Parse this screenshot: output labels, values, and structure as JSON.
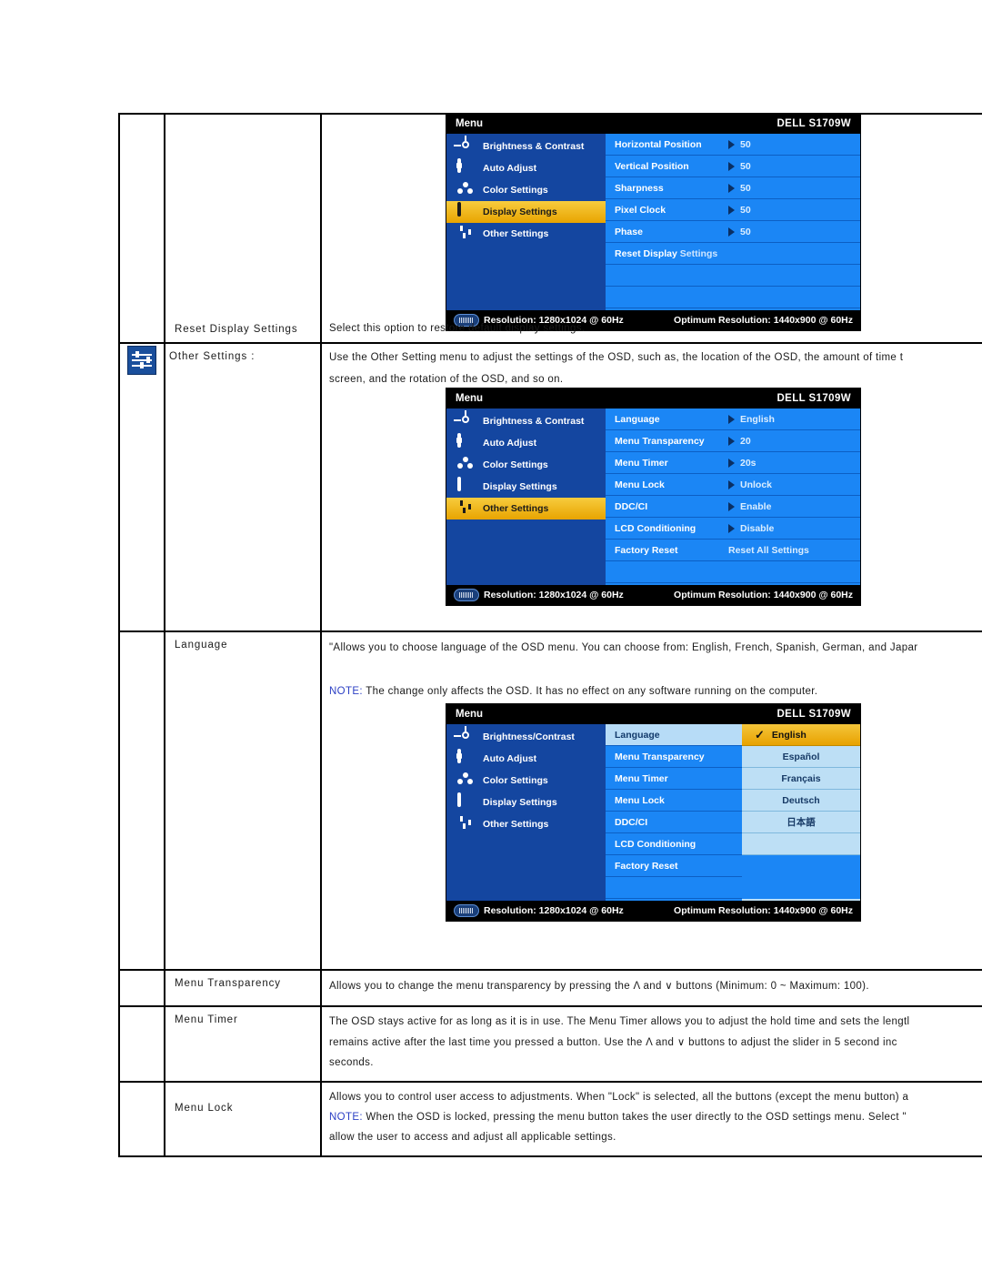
{
  "document": {
    "rows": [
      {
        "id": "reset-display-settings",
        "icon": null,
        "label": "Reset Display Settings",
        "body_lines": [
          "Select this option to restore default display settings."
        ],
        "osd": null
      },
      {
        "id": "other-settings",
        "icon": "sliders-icon",
        "label": "Other Settings :",
        "body_lines": [
          "Use the Other Setting menu to adjust the settings of the OSD, such as, the location of the OSD, the amount of time t",
          "screen, and the rotation of the OSD, and so on."
        ],
        "osd": "other_settings_menu"
      },
      {
        "id": "language",
        "icon": null,
        "label": "Language",
        "body_lines": [
          "\"Allows you to choose language of the OSD menu. You can choose from: English, French, Spanish, German, and Japar",
          "",
          "NOTE: The change only affects the OSD. It has no effect on any software running on the computer."
        ],
        "note_prefix": "NOTE:",
        "osd": "language_menu"
      },
      {
        "id": "menu-transparency",
        "icon": null,
        "label": "Menu Transparency",
        "body_lines": [
          "Allows you to change the menu transparency by pressing the Λ and ∨ buttons (Minimum: 0 ~ Maximum: 100)."
        ],
        "osd": null
      },
      {
        "id": "menu-timer",
        "icon": null,
        "label": "Menu Timer",
        "body_lines": [
          "The OSD stays active for as long as it is in use. The Menu Timer allows you to adjust the hold time and sets the lengtl",
          "remains active after the last time you pressed a button. Use the Λ and ∨ buttons to adjust the slider in 5 second inc",
          "seconds."
        ],
        "osd": null
      },
      {
        "id": "menu-lock",
        "icon": null,
        "label": "Menu Lock",
        "body_lines": [
          "Allows you to control user access to adjustments. When \"Lock\" is selected, all the buttons (except the menu button) a",
          "NOTE: When the OSD is locked, pressing the menu button takes the user directly to the OSD settings menu. Select \"",
          "allow the user to access and adjust all applicable settings."
        ],
        "note_prefix": "NOTE:",
        "osd": null
      }
    ]
  },
  "osd_common": {
    "title": "Menu",
    "brand": "DELL S1709W",
    "status_resolution": "Resolution: 1280x1024 @ 60Hz",
    "status_optimum": "Optimum Resolution: 1440x900 @ 60Hz",
    "vga_icon": "vga-connector-icon"
  },
  "display_settings_menu": {
    "left_items": [
      {
        "label": "Brightness & Contrast",
        "icon": "brightness-icon",
        "active": false
      },
      {
        "label": "Auto Adjust",
        "icon": "auto-adjust-icon",
        "active": false
      },
      {
        "label": "Color Settings",
        "icon": "color-settings-icon",
        "active": false
      },
      {
        "label": "Display Settings",
        "icon": "display-settings-icon",
        "active": true
      },
      {
        "label": "Other Settings",
        "icon": "other-settings-icon",
        "active": false
      }
    ],
    "rows": [
      {
        "label": "Horizontal Position",
        "value": "50",
        "arrow": true
      },
      {
        "label": "Vertical Position",
        "value": "50",
        "arrow": true
      },
      {
        "label": "Sharpness",
        "value": "50",
        "arrow": true
      },
      {
        "label": "Pixel Clock",
        "value": "50",
        "arrow": true
      },
      {
        "label": "Phase",
        "value": "50",
        "arrow": true
      },
      {
        "label": "Reset Display",
        "label2": "Settings",
        "value": "",
        "arrow": false
      },
      {
        "label": "",
        "value": "",
        "arrow": false
      },
      {
        "label": "",
        "value": "",
        "arrow": false
      }
    ]
  },
  "other_settings_menu": {
    "left_items": [
      {
        "label": "Brightness & Contrast",
        "icon": "brightness-icon",
        "active": false
      },
      {
        "label": "Auto Adjust",
        "icon": "auto-adjust-icon",
        "active": false
      },
      {
        "label": "Color Settings",
        "icon": "color-settings-icon",
        "active": false
      },
      {
        "label": "Display Settings",
        "icon": "display-settings-icon",
        "active": false
      },
      {
        "label": "Other Settings",
        "icon": "other-settings-icon",
        "active": true
      }
    ],
    "rows": [
      {
        "label": "Language",
        "value": "English",
        "arrow": true
      },
      {
        "label": "Menu Transparency",
        "value": "20",
        "arrow": true
      },
      {
        "label": "Menu Timer",
        "value": "20s",
        "arrow": true
      },
      {
        "label": "Menu Lock",
        "value": "Unlock",
        "arrow": true
      },
      {
        "label": "DDC/CI",
        "value": "Enable",
        "arrow": true
      },
      {
        "label": "LCD Conditioning",
        "value": "Disable",
        "arrow": true
      },
      {
        "label": "Factory Reset",
        "value": "Reset All Settings",
        "arrow": false
      },
      {
        "label": "",
        "value": "",
        "arrow": false
      }
    ]
  },
  "language_menu": {
    "left_items": [
      {
        "label": "Brightness/Contrast",
        "icon": "brightness-icon",
        "active": false
      },
      {
        "label": "Auto Adjust",
        "icon": "auto-adjust-icon",
        "active": false
      },
      {
        "label": "Color Settings",
        "icon": "color-settings-icon",
        "active": false
      },
      {
        "label": "Display Settings",
        "icon": "display-settings-icon",
        "active": false
      },
      {
        "label": "Other Settings",
        "icon": "other-settings-icon",
        "active": false
      }
    ],
    "rows": [
      {
        "label": "Language",
        "active": true
      },
      {
        "label": "Menu Transparency",
        "active": false
      },
      {
        "label": "Menu Timer",
        "active": false
      },
      {
        "label": "Menu Lock",
        "active": false
      },
      {
        "label": "DDC/CI",
        "active": false
      },
      {
        "label": "LCD Conditioning",
        "active": false
      },
      {
        "label": "Factory Reset",
        "active": false
      },
      {
        "label": "",
        "active": false
      }
    ],
    "languages": [
      {
        "label": "English",
        "selected": true,
        "check": "✓"
      },
      {
        "label": "Español",
        "selected": false
      },
      {
        "label": "Français",
        "selected": false
      },
      {
        "label": "Deutsch",
        "selected": false
      },
      {
        "label": "日本語",
        "selected": false
      }
    ]
  },
  "colors": {
    "osd_panel_blue": "#1b86f5",
    "osd_left_blue": "#1446a0",
    "osd_highlight_gold": "#e8a400",
    "osd_title_black": "#000000",
    "lang_panel_light": "#bddff5",
    "note_blue": "#2b3fc4",
    "doc_icon_blue": "#1a4f9c"
  }
}
